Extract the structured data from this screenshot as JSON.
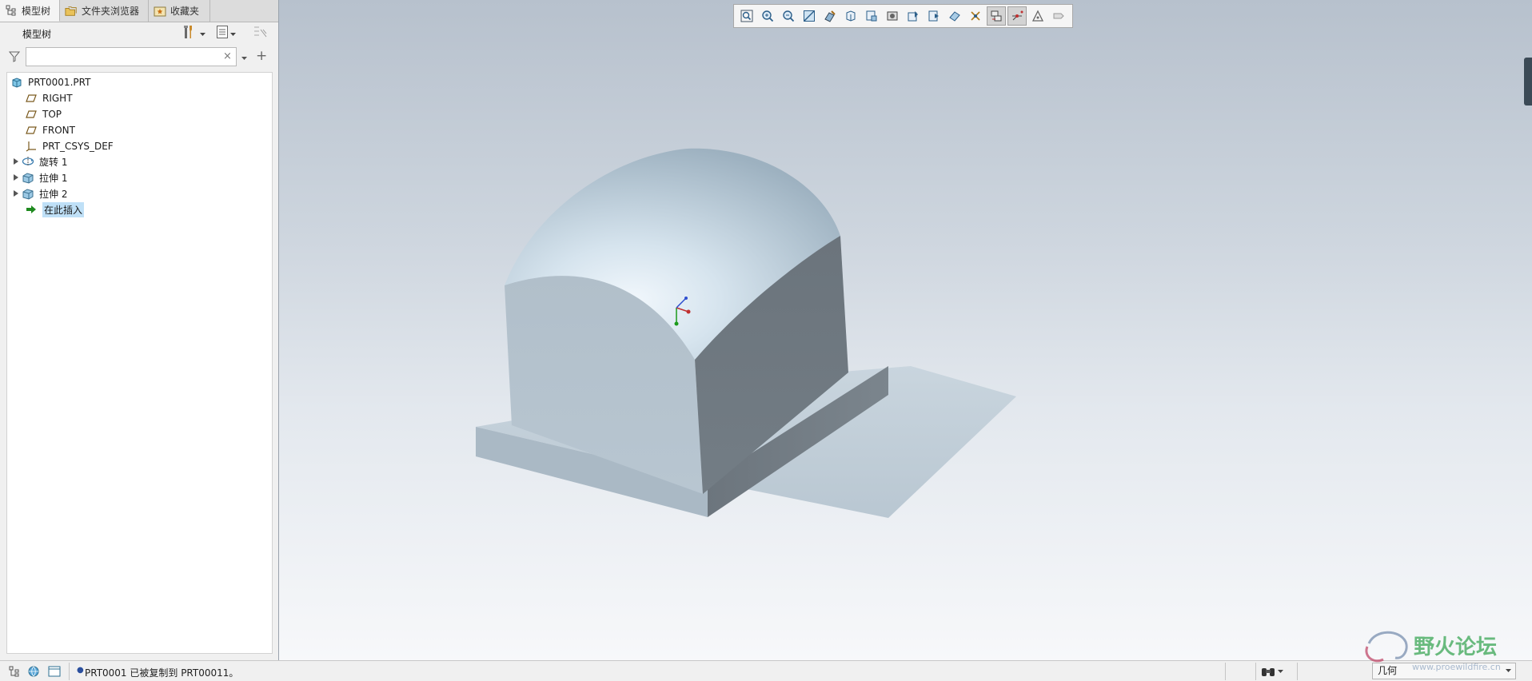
{
  "panel_tabs": [
    {
      "label": "模型树",
      "icon": "model-tree-icon",
      "active": true
    },
    {
      "label": "文件夹浏览器",
      "icon": "folder-browser-icon",
      "active": false
    },
    {
      "label": "收藏夹",
      "icon": "favorites-icon",
      "active": false
    }
  ],
  "model_tree": {
    "header": "模型树",
    "search_value": "",
    "search_clear": "×",
    "add_symbol": "+",
    "nodes": [
      {
        "label": "PRT0001.PRT",
        "icon": "part-icon",
        "expandable": false
      },
      {
        "label": "RIGHT",
        "icon": "datum-plane-icon",
        "expandable": false
      },
      {
        "label": "TOP",
        "icon": "datum-plane-icon",
        "expandable": false
      },
      {
        "label": "FRONT",
        "icon": "datum-plane-icon",
        "expandable": false
      },
      {
        "label": "PRT_CSYS_DEF",
        "icon": "csys-icon",
        "expandable": false
      },
      {
        "label": "旋转 1",
        "icon": "revolve-icon",
        "expandable": true
      },
      {
        "label": "拉伸 1",
        "icon": "extrude-icon",
        "expandable": true
      },
      {
        "label": "拉伸 2",
        "icon": "extrude-icon",
        "expandable": true
      },
      {
        "label": "在此插入",
        "icon": "insert-arrow-icon",
        "expandable": false,
        "highlighted": true
      }
    ]
  },
  "view_toolbar": [
    "refit-icon",
    "zoom-in-icon",
    "zoom-out-icon",
    "repaint-icon",
    "display-style-icon",
    "saved-orientations-icon",
    "view-manager-icon",
    "perspective-icon",
    "section-icon",
    "appearance-icon",
    "datum-display-icon",
    "annotation-display-icon",
    "spin-center-icon",
    "csys-display-icon",
    "point-display-icon",
    "plane-tag-icon"
  ],
  "status_bar": {
    "message": "PRT0001 已被复制到 PRT00011。",
    "selection_filter": "几何"
  },
  "watermark": {
    "text": "野火论坛",
    "url": "www.proewildfire.cn"
  },
  "colors": {
    "tree_highlight": "#bfe0f7",
    "model_top_face": "#a9bdcb",
    "model_right_face": "#6f7880",
    "model_front_face": "#b4c2cd",
    "axis_x": "#c03030",
    "axis_y": "#2f4fcf",
    "axis_z": "#1a9a1a",
    "watermark_green": "#3aa655"
  }
}
